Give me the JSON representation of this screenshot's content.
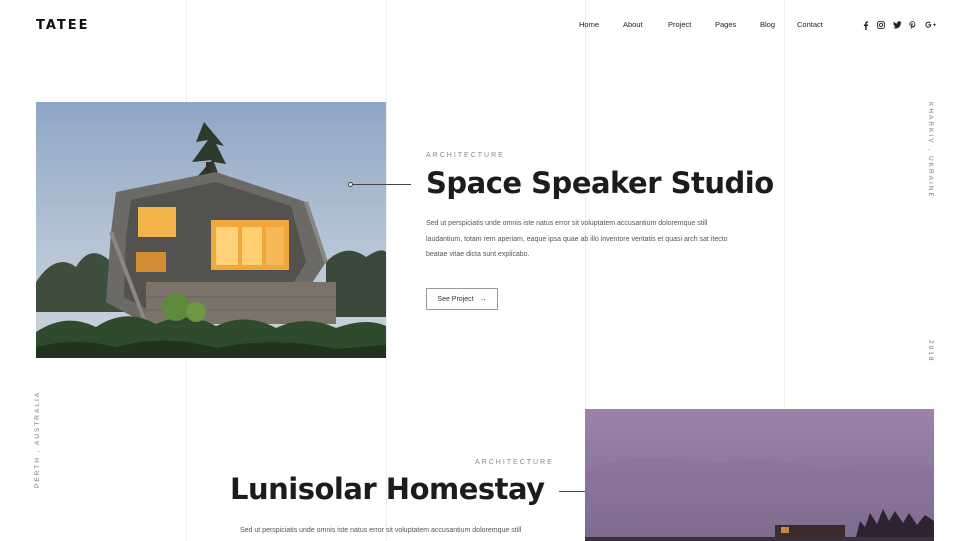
{
  "brand": {
    "logo": "TATEE"
  },
  "nav": {
    "items": [
      "Home",
      "About",
      "Project",
      "Pages",
      "Blog",
      "Contact"
    ]
  },
  "social": {
    "icons": [
      {
        "name": "facebook-icon",
        "glyph": "f"
      },
      {
        "name": "instagram-icon",
        "glyph": "◎"
      },
      {
        "name": "twitter-icon",
        "glyph": "🐦"
      },
      {
        "name": "pinterest-icon",
        "glyph": "𝓅"
      },
      {
        "name": "google-plus-icon",
        "glyph": "G+"
      }
    ]
  },
  "side": {
    "location_right": "KHARKIV , UKRAINE",
    "year_right": "2018",
    "location_left": "PERTH , AUSTRALIA"
  },
  "projects": [
    {
      "category": "ARCHITECTURE",
      "title": "Space Speaker Studio",
      "description": "Sed ut perspiciatis unde omnis iste natus error sit voluptatem accusantium doloremque still laudantium, totam rem aperiam, eaque ipsa quae ab illo inventore veritatis et quasi arch sat itecto beatae vitae dicta sunt explicabo.",
      "button": "See Project",
      "button_icon": "→"
    },
    {
      "category": "ARCHITECTURE",
      "title": "Lunisolar Homestay",
      "description": "Sed ut perspiciatis unde omnis iste natus error sit voluptatem accusantium doloremque still"
    }
  ],
  "colors": {
    "text": "#1c1c1c",
    "muted": "#888888",
    "gridline": "#efefef",
    "sky1": "#9fb2c9",
    "sky2": "#9a7fa6"
  }
}
